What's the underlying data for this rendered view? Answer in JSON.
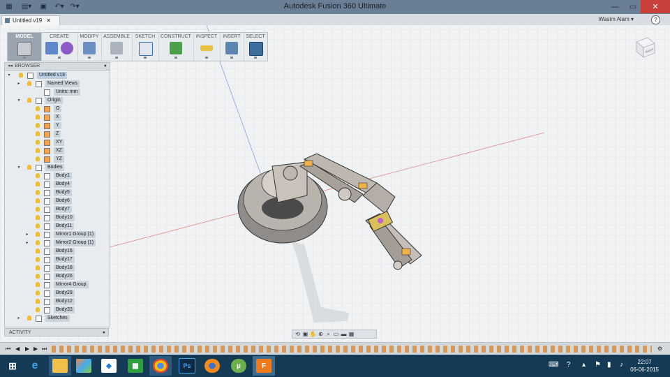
{
  "window": {
    "title": "Autodesk Fusion 360 Ultimate"
  },
  "quick_access": {
    "icons": [
      "grid-icon",
      "file-icon",
      "save-icon",
      "undo-icon",
      "redo-icon"
    ]
  },
  "tab": {
    "label": "Untitled v19"
  },
  "user": {
    "name": "Wasim Alam ▾",
    "help": "?"
  },
  "toolbar": {
    "workspace": "MODEL",
    "groups": [
      "CREATE",
      "MODIFY",
      "ASSEMBLE",
      "SKETCH",
      "CONSTRUCT",
      "INSPECT",
      "INSERT",
      "SELECT"
    ]
  },
  "browser": {
    "title": "BROWSER",
    "root": "Untitled v19",
    "items": [
      {
        "label": "Named Views"
      },
      {
        "label": "Units: mm"
      },
      {
        "label": "Origin"
      },
      {
        "label": "O"
      },
      {
        "label": "X"
      },
      {
        "label": "Y"
      },
      {
        "label": "Z"
      },
      {
        "label": "XY"
      },
      {
        "label": "XZ"
      },
      {
        "label": "YZ"
      },
      {
        "label": "Bodies"
      },
      {
        "label": "Body1"
      },
      {
        "label": "Body4"
      },
      {
        "label": "Body5"
      },
      {
        "label": "Body6"
      },
      {
        "label": "Body7"
      },
      {
        "label": "Body10"
      },
      {
        "label": "Body11"
      },
      {
        "label": "Mirror1 Group (1)"
      },
      {
        "label": "Mirror2 Group (1)"
      },
      {
        "label": "Body16"
      },
      {
        "label": "Body17"
      },
      {
        "label": "Body18"
      },
      {
        "label": "Body26"
      },
      {
        "label": "Mirror4 Group"
      },
      {
        "label": "Body29"
      },
      {
        "label": "Body12"
      },
      {
        "label": "Body33"
      },
      {
        "label": "Sketches"
      }
    ]
  },
  "activity": {
    "title": "ACTIVITY"
  },
  "viewcube": {
    "face": "RIGHT"
  },
  "clock": {
    "time": "22:07",
    "date": "06-06-2015"
  },
  "taskbar": {
    "apps": [
      "windows-start",
      "internet-explorer",
      "file-explorer",
      "paint-app",
      "dropbox",
      "store",
      "chrome",
      "photoshop",
      "firefox",
      "utorrent",
      "fusion360"
    ]
  }
}
